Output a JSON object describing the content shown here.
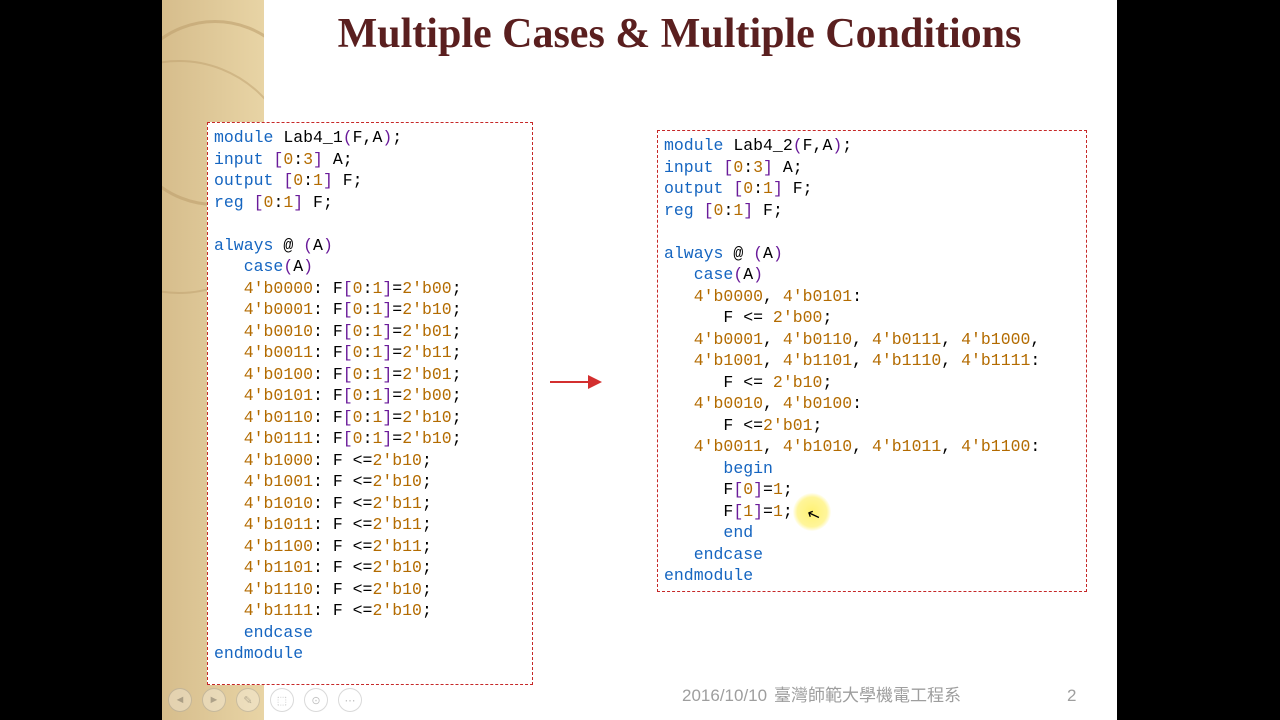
{
  "title": "Multiple Cases & Multiple Conditions",
  "left_code_html": "<span class=\"kw\">module</span> Lab4_1<span class=\"par\">(</span>F,A<span class=\"par\">)</span>;\n<span class=\"kw\">input</span> <span class=\"par\">[</span><span class=\"num\">0</span>:<span class=\"num\">3</span><span class=\"par\">]</span> A;\n<span class=\"kw\">output</span> <span class=\"par\">[</span><span class=\"num\">0</span>:<span class=\"num\">1</span><span class=\"par\">]</span> F;\n<span class=\"kw\">reg</span> <span class=\"par\">[</span><span class=\"num\">0</span>:<span class=\"num\">1</span><span class=\"par\">]</span> F;\n\n<span class=\"kw\">always</span> @ <span class=\"par\">(</span>A<span class=\"par\">)</span>\n   <span class=\"kw\">case</span><span class=\"par\">(</span>A<span class=\"par\">)</span>\n   <span class=\"num\">4'b0000</span>: F<span class=\"par\">[</span><span class=\"num\">0</span>:<span class=\"num\">1</span><span class=\"par\">]</span>=<span class=\"num\">2'b00</span>;\n   <span class=\"num\">4'b0001</span>: F<span class=\"par\">[</span><span class=\"num\">0</span>:<span class=\"num\">1</span><span class=\"par\">]</span>=<span class=\"num\">2'b10</span>;\n   <span class=\"num\">4'b0010</span>: F<span class=\"par\">[</span><span class=\"num\">0</span>:<span class=\"num\">1</span><span class=\"par\">]</span>=<span class=\"num\">2'b01</span>;\n   <span class=\"num\">4'b0011</span>: F<span class=\"par\">[</span><span class=\"num\">0</span>:<span class=\"num\">1</span><span class=\"par\">]</span>=<span class=\"num\">2'b11</span>;\n   <span class=\"num\">4'b0100</span>: F<span class=\"par\">[</span><span class=\"num\">0</span>:<span class=\"num\">1</span><span class=\"par\">]</span>=<span class=\"num\">2'b01</span>;\n   <span class=\"num\">4'b0101</span>: F<span class=\"par\">[</span><span class=\"num\">0</span>:<span class=\"num\">1</span><span class=\"par\">]</span>=<span class=\"num\">2'b00</span>;\n   <span class=\"num\">4'b0110</span>: F<span class=\"par\">[</span><span class=\"num\">0</span>:<span class=\"num\">1</span><span class=\"par\">]</span>=<span class=\"num\">2'b10</span>;\n   <span class=\"num\">4'b0111</span>: F<span class=\"par\">[</span><span class=\"num\">0</span>:<span class=\"num\">1</span><span class=\"par\">]</span>=<span class=\"num\">2'b10</span>;\n   <span class=\"num\">4'b1000</span>: F &lt;=<span class=\"num\">2'b10</span>;\n   <span class=\"num\">4'b1001</span>: F &lt;=<span class=\"num\">2'b10</span>;\n   <span class=\"num\">4'b1010</span>: F &lt;=<span class=\"num\">2'b11</span>;\n   <span class=\"num\">4'b1011</span>: F &lt;=<span class=\"num\">2'b11</span>;\n   <span class=\"num\">4'b1100</span>: F &lt;=<span class=\"num\">2'b11</span>;\n   <span class=\"num\">4'b1101</span>: F &lt;=<span class=\"num\">2'b10</span>;\n   <span class=\"num\">4'b1110</span>: F &lt;=<span class=\"num\">2'b10</span>;\n   <span class=\"num\">4'b1111</span>: F &lt;=<span class=\"num\">2'b10</span>;\n   <span class=\"kw\">endcase</span>\n<span class=\"kw\">endmodule</span>",
  "right_code_html": "<span class=\"kw\">module</span> Lab4_2<span class=\"par\">(</span>F,A<span class=\"par\">)</span>;\n<span class=\"kw\">input</span> <span class=\"par\">[</span><span class=\"num\">0</span>:<span class=\"num\">3</span><span class=\"par\">]</span> A;\n<span class=\"kw\">output</span> <span class=\"par\">[</span><span class=\"num\">0</span>:<span class=\"num\">1</span><span class=\"par\">]</span> F;\n<span class=\"kw\">reg</span> <span class=\"par\">[</span><span class=\"num\">0</span>:<span class=\"num\">1</span><span class=\"par\">]</span> F;\n\n<span class=\"kw\">always</span> @ <span class=\"par\">(</span>A<span class=\"par\">)</span>\n   <span class=\"kw\">case</span><span class=\"par\">(</span>A<span class=\"par\">)</span>\n   <span class=\"num\">4'b0000</span>, <span class=\"num\">4'b0101</span>:\n      F &lt;= <span class=\"num\">2'b00</span>;\n   <span class=\"num\">4'b0001</span>, <span class=\"num\">4'b0110</span>, <span class=\"num\">4'b0111</span>, <span class=\"num\">4'b1000</span>,\n   <span class=\"num\">4'b1001</span>, <span class=\"num\">4'b1101</span>, <span class=\"num\">4'b1110</span>, <span class=\"num\">4'b1111</span>:\n      F &lt;= <span class=\"num\">2'b10</span>;\n   <span class=\"num\">4'b0010</span>, <span class=\"num\">4'b0100</span>:\n      F &lt;=<span class=\"num\">2'b01</span>;\n   <span class=\"num\">4'b0011</span>, <span class=\"num\">4'b1010</span>, <span class=\"num\">4'b1011</span>, <span class=\"num\">4'b1100</span>:\n      <span class=\"kw\">begin</span>\n      F<span class=\"par\">[</span><span class=\"num\">0</span><span class=\"par\">]</span>=<span class=\"num\">1</span>;\n      F<span class=\"par\">[</span><span class=\"num\">1</span><span class=\"par\">]</span>=<span class=\"num\">1</span>;\n      <span class=\"kw\">end</span>\n   <span class=\"kw\">endcase</span>\n<span class=\"kw\">endmodule</span>",
  "footer": {
    "date": "2016/10/10",
    "university": "臺灣師範大學機電工程系",
    "page": "2"
  },
  "nav_icons": [
    "◄",
    "►",
    "✎",
    "⬚",
    "⊙",
    "⋯"
  ]
}
